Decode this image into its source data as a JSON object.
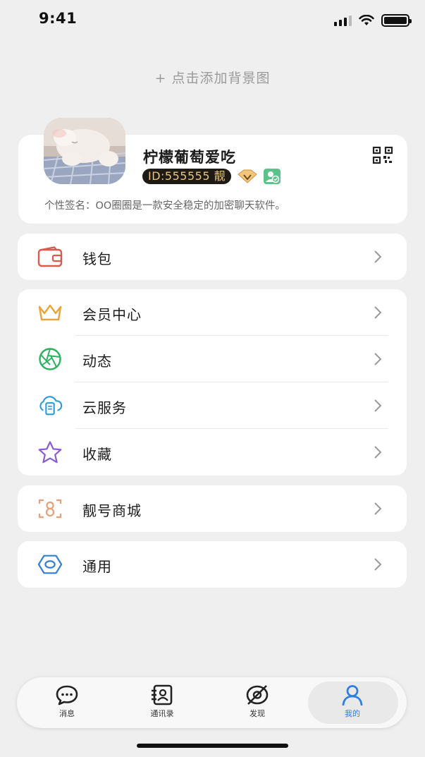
{
  "status_bar": {
    "time": "9:41"
  },
  "header": {
    "add_background": "+ 点击添加背景图"
  },
  "profile": {
    "nickname": "柠檬葡萄爱吃",
    "id_badge": "ID:555555 靓",
    "signature": "个性签名：OO圈圈是一款安全稳定的加密聊天软件。"
  },
  "menu": {
    "wallet": "钱包",
    "member_center": "会员中心",
    "moments": "动态",
    "cloud_service": "云服务",
    "favorites": "收藏",
    "premium_id_mall": "靓号商城",
    "general": "通用"
  },
  "tabbar": {
    "messages": "消息",
    "contacts": "通讯录",
    "discover": "发现",
    "me": "我的"
  },
  "colors": {
    "background": "#efefef",
    "card": "#ffffff",
    "accent_blue": "#2e7ee6",
    "wallet_red": "#e0574a",
    "crown_gold": "#e9a43a",
    "moments_green": "#2bb35f",
    "cloud_blue": "#2c9ad9",
    "star_purple": "#8a5bd6",
    "mall_orange": "#e8a07a",
    "general_blue": "#2f7fd8"
  }
}
